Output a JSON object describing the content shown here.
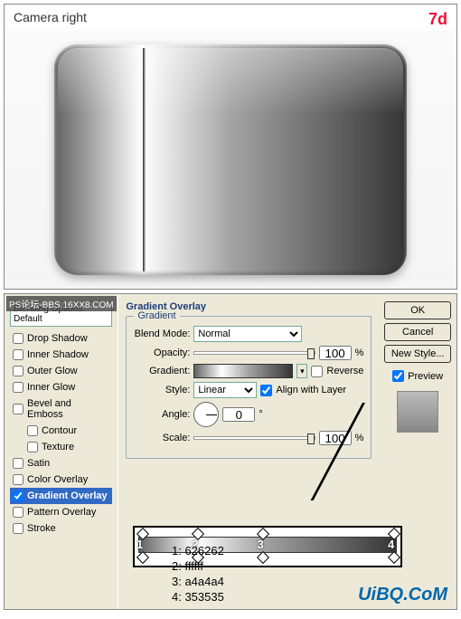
{
  "header": {
    "title": "Camera right",
    "step": "7d"
  },
  "watermark": "PS论坛-BBS.16XX8.COM",
  "blending": {
    "heading": "Blending Options: Default",
    "items": [
      {
        "label": "Drop Shadow",
        "checked": false
      },
      {
        "label": "Inner Shadow",
        "checked": false
      },
      {
        "label": "Outer Glow",
        "checked": false
      },
      {
        "label": "Inner Glow",
        "checked": false
      },
      {
        "label": "Bevel and Emboss",
        "checked": false
      },
      {
        "label": "Contour",
        "checked": false,
        "sub": true
      },
      {
        "label": "Texture",
        "checked": false,
        "sub": true
      },
      {
        "label": "Satin",
        "checked": false
      },
      {
        "label": "Color Overlay",
        "checked": false
      },
      {
        "label": "Gradient Overlay",
        "checked": true,
        "selected": true
      },
      {
        "label": "Pattern Overlay",
        "checked": false
      },
      {
        "label": "Stroke",
        "checked": false
      }
    ]
  },
  "panel": {
    "title": "Gradient Overlay",
    "group": "Gradient",
    "blendmode_label": "Blend Mode:",
    "blendmode": "Normal",
    "opacity_label": "Opacity:",
    "opacity": "100",
    "pct": "%",
    "gradient_label": "Gradient:",
    "reverse_label": "Reverse",
    "reverse": false,
    "style_label": "Style:",
    "style": "Linear",
    "align_label": "Align with Layer",
    "align": true,
    "angle_label": "Angle:",
    "angle": "0",
    "deg": "°",
    "scale_label": "Scale:",
    "scale": "100"
  },
  "buttons": {
    "ok": "OK",
    "cancel": "Cancel",
    "newstyle": "New Style...",
    "preview": "Preview"
  },
  "stops": [
    {
      "n": "1",
      "hex": "626262",
      "pos": 0
    },
    {
      "n": "2",
      "hex": "ffffff",
      "pos": 22
    },
    {
      "n": "3",
      "hex": "a4a4a4",
      "pos": 48
    },
    {
      "n": "4",
      "hex": "353535",
      "pos": 100
    }
  ],
  "stoplist": [
    "1: 626262",
    "2: ffffff",
    "3: a4a4a4",
    "4: 353535"
  ],
  "brand": "UiBQ.CoM"
}
